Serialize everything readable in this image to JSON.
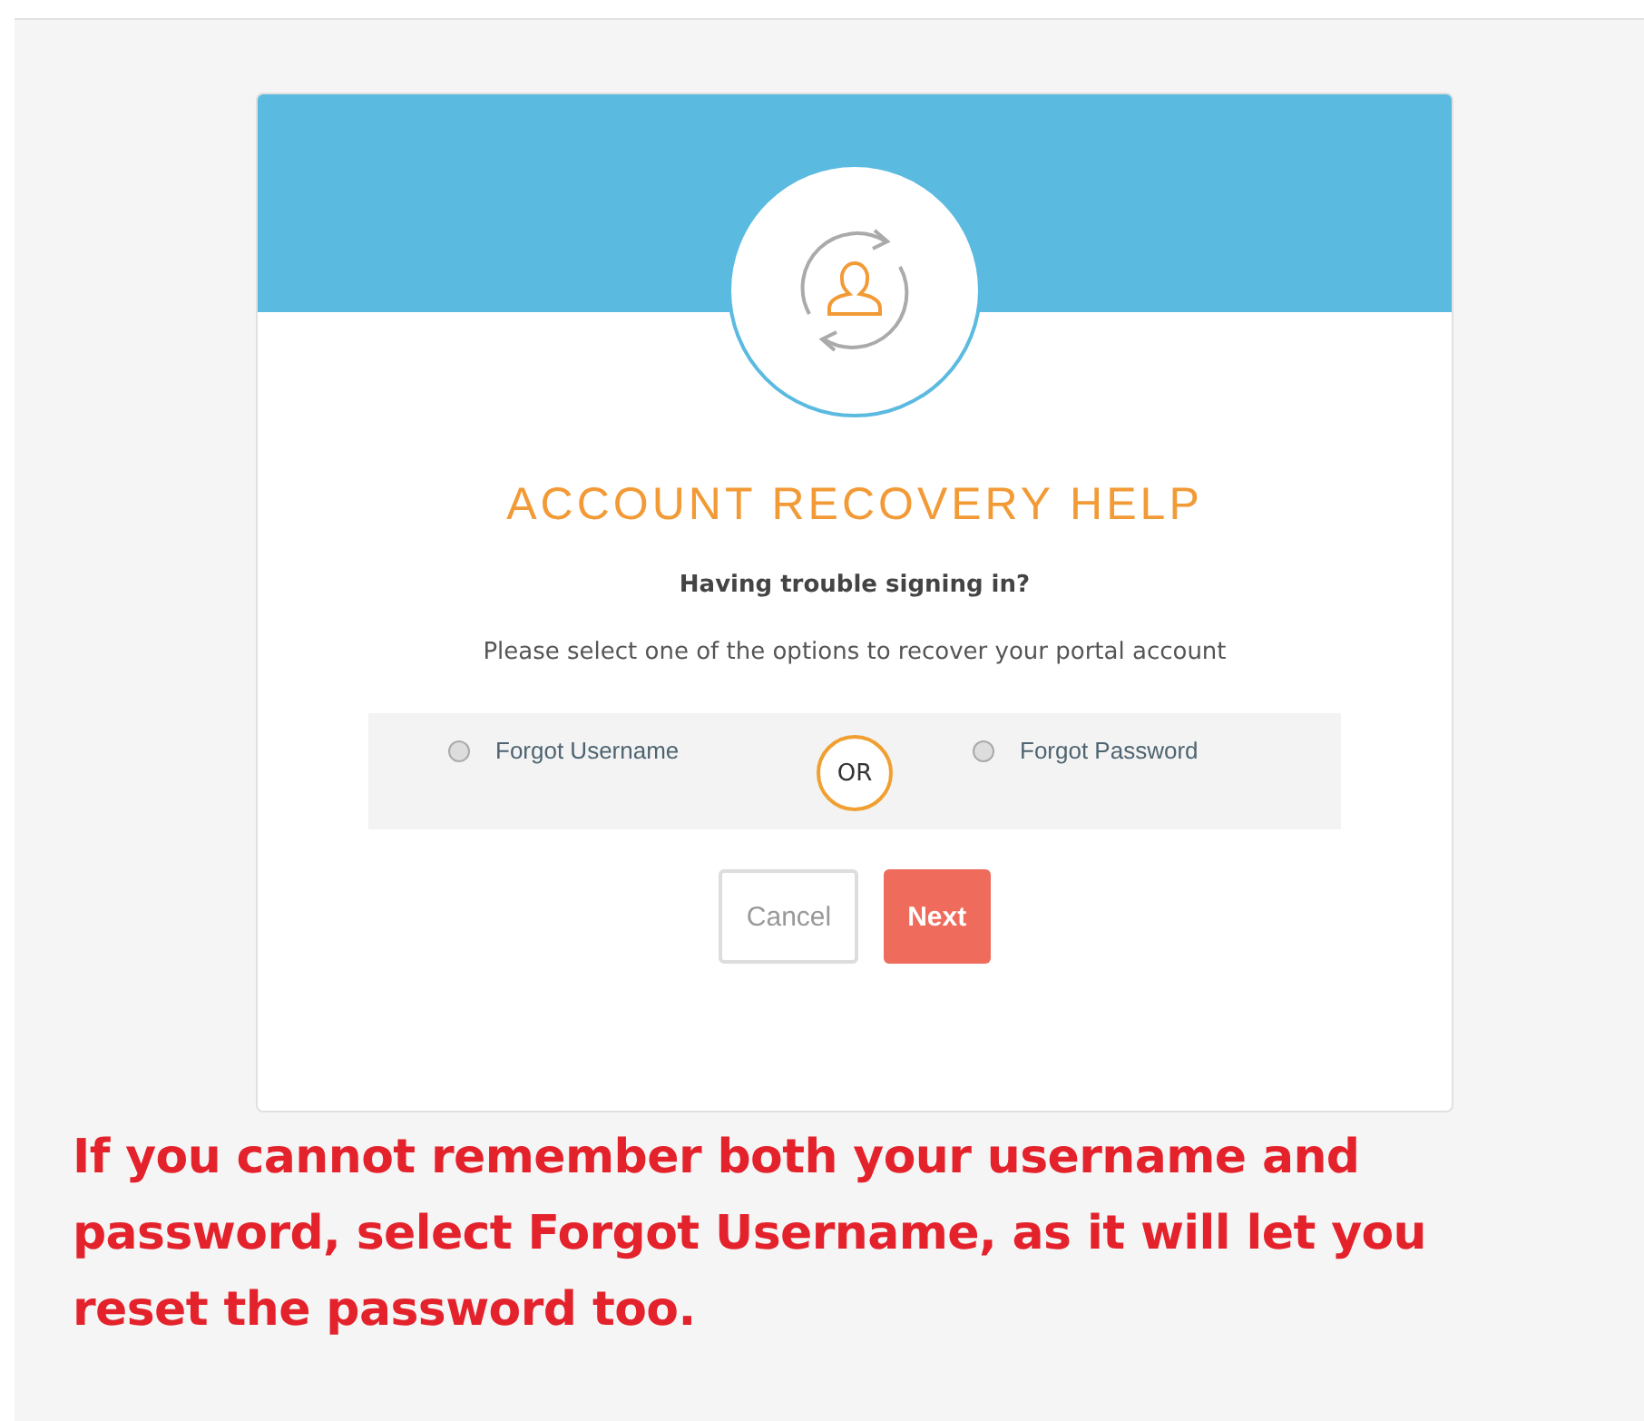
{
  "card": {
    "title": "ACCOUNT RECOVERY HELP",
    "subtitle": "Having trouble signing in?",
    "instructions": "Please select one of the options to recover your portal account",
    "options": [
      {
        "label": "Forgot Username",
        "selected": false
      },
      {
        "label": "Forgot Password",
        "selected": false
      }
    ],
    "separator": "OR",
    "buttons": [
      {
        "label": "Cancel",
        "kind": "secondary"
      },
      {
        "label": "Next",
        "kind": "primary"
      }
    ]
  },
  "note": "If you cannot remember both your username and password, select Forgot Username, as it will let you reset the password too."
}
